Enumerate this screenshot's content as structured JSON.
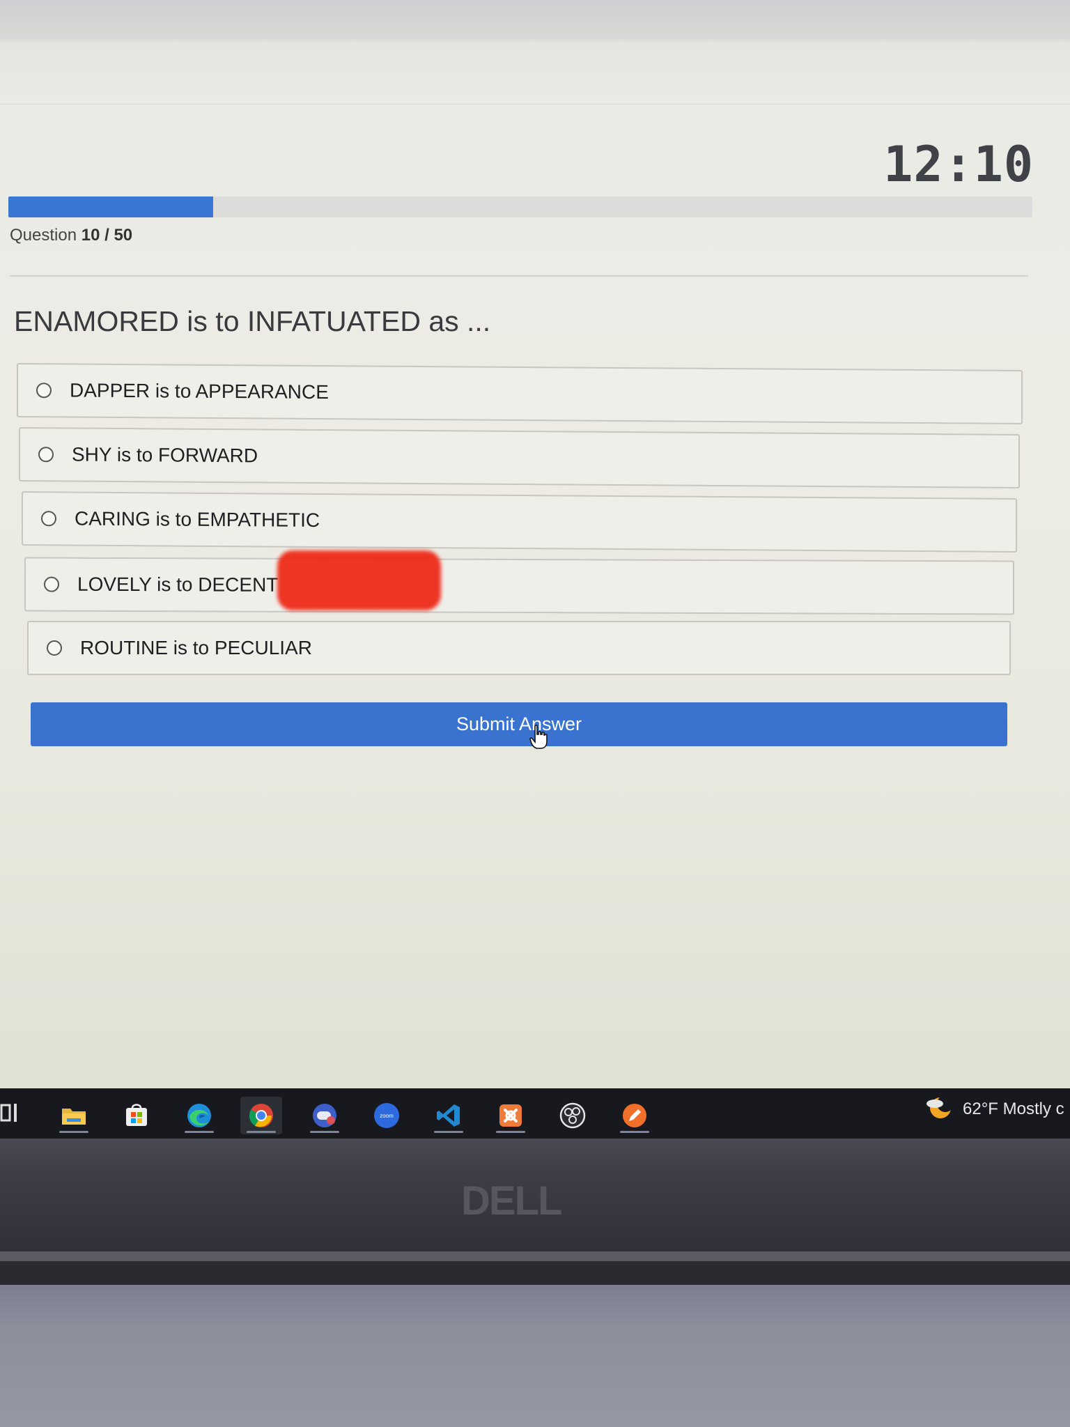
{
  "timer": "12:10",
  "progress": {
    "current": 10,
    "total": 50,
    "fraction": 0.2,
    "label_prefix": "Question",
    "current_label": "10",
    "separator": " / ",
    "total_label": "50"
  },
  "question": {
    "text": "ENAMORED is to INFATUATED as ..."
  },
  "options": [
    {
      "label": "DAPPER is to APPEARANCE"
    },
    {
      "label": "SHY is to FORWARD"
    },
    {
      "label": "CARING is to EMPATHETIC"
    },
    {
      "label": "LOVELY is to DECENT"
    },
    {
      "label": "ROUTINE is to PECULIAR"
    }
  ],
  "submit": {
    "label": "Submit Answer"
  },
  "taskbar": {
    "apps": [
      "file-explorer-icon",
      "microsoft-store-icon",
      "edge-icon",
      "chrome-icon",
      "game-app-icon",
      "zoom-icon",
      "vscode-icon",
      "xampp-icon",
      "obs-icon",
      "pen-app-icon"
    ],
    "zoom_label": "zoom",
    "weather": "62°F  Mostly c"
  },
  "brand": "DELL",
  "colors": {
    "accent": "#3a76d4",
    "redaction": "#ee2a18",
    "taskbar": "#17191f"
  }
}
